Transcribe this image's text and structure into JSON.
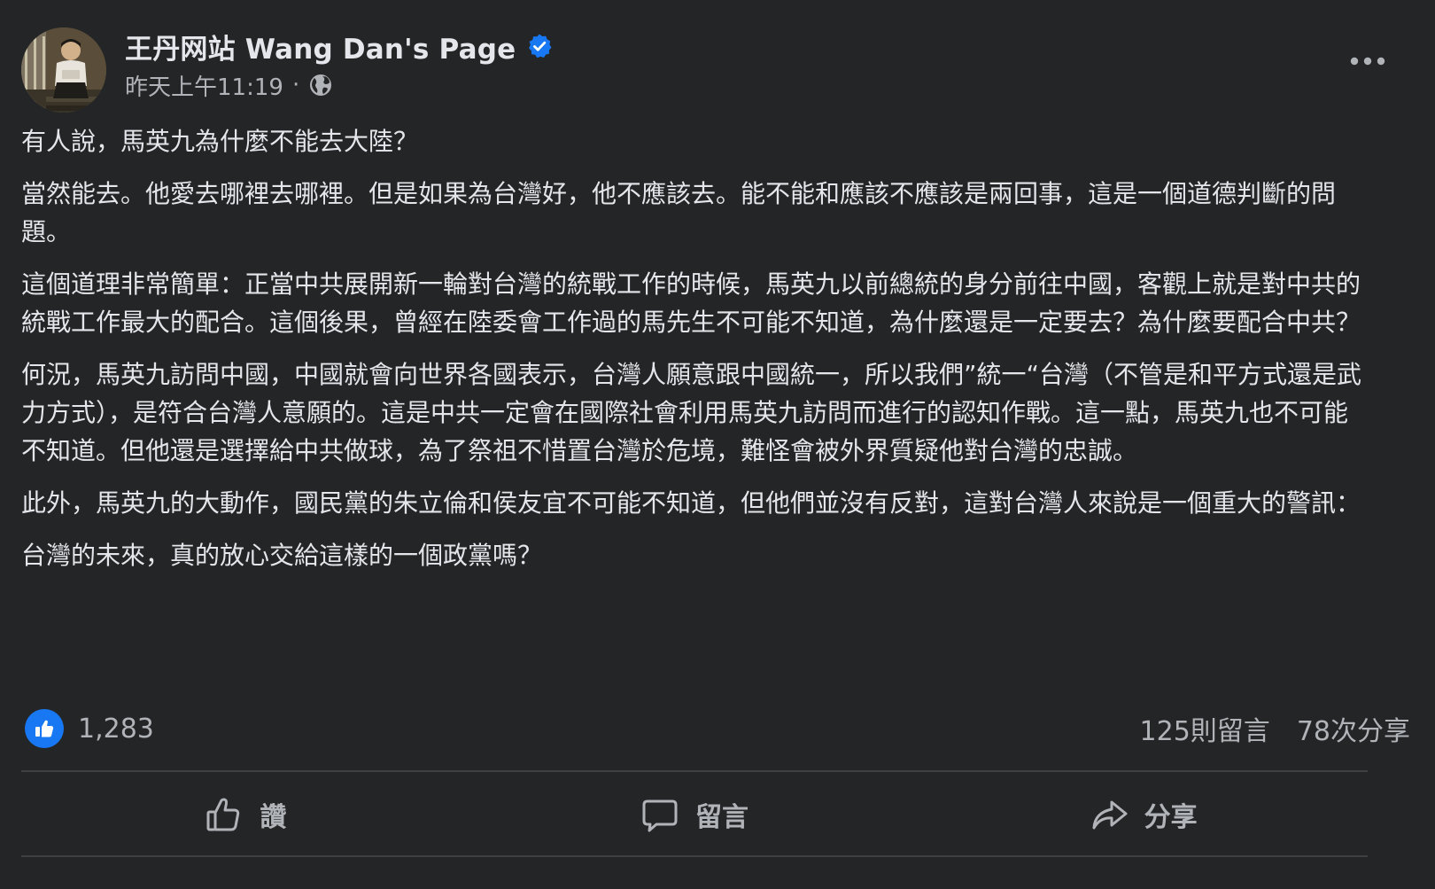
{
  "post": {
    "page_name": "王丹网站 Wang Dan's Page",
    "timestamp": "昨天上午11:19",
    "separator": "·",
    "audience_icon": "globe-icon",
    "verified_icon": "verified-badge-icon",
    "more_icon": "more-options-icon",
    "paragraphs": [
      "有人說，馬英九為什麼不能去大陸？",
      "當然能去。他愛去哪裡去哪裡。但是如果為台灣好，他不應該去。能不能和應該不應該是兩回事，這是一個道德判斷的問題。",
      "這個道理非常簡單：正當中共展開新一輪對台灣的統戰工作的時候，馬英九以前總統的身分前往中國，客觀上就是對中共的統戰工作最大的配合。這個後果，曾經在陸委會工作過的馬先生不可能不知道，為什麼還是一定要去？為什麼要配合中共？",
      "何況，馬英九訪問中國，中國就會向世界各國表示，台灣人願意跟中國統一，所以我們”統一“台灣（不管是和平方式還是武力方式），是符合台灣人意願的。這是中共一定會在國際社會利用馬英九訪問而進行的認知作戰。這一點，馬英九也不可能不知道。但他還是選擇給中共做球，為了祭祖不惜置台灣於危境，難怪會被外界質疑他對台灣的忠誠。",
      "此外，馬英九的大動作，國民黨的朱立倫和侯友宜不可能不知道，但他們並沒有反對，這對台灣人來說是一個重大的警訊：",
      "台灣的未來，真的放心交給這樣的一個政黨嗎？"
    ]
  },
  "stats": {
    "like_icon": "thumbs-up-icon",
    "like_count": "1,283",
    "comments": "125則留言",
    "shares": "78次分享"
  },
  "actions": {
    "like_label": "讚",
    "comment_label": "留言",
    "share_label": "分享"
  },
  "colors": {
    "background": "#242526",
    "text_primary": "#e4e6eb",
    "text_secondary": "#b0b3b8",
    "accent": "#1877f2",
    "divider": "#3e4042"
  }
}
